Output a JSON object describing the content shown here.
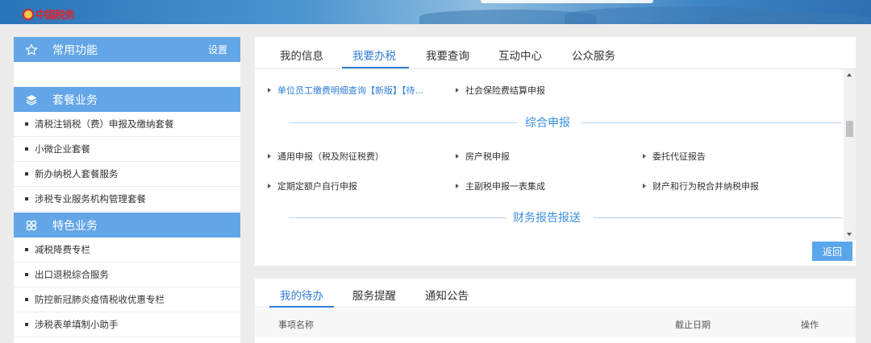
{
  "header": {
    "logo_text": "中国税务"
  },
  "sidebar": {
    "common": {
      "title": "常用功能",
      "setting": "设置"
    },
    "package": {
      "title": "套餐业务",
      "items": [
        "清税注销税（费）申报及缴纳套餐",
        "小微企业套餐",
        "新办纳税人套餐服务",
        "涉税专业服务机构管理套餐"
      ]
    },
    "special": {
      "title": "特色业务",
      "items": [
        "减税降费专栏",
        "出口退税综合服务",
        "防控新冠肺炎疫情税收优惠专栏",
        "涉税表单填制小助手"
      ]
    }
  },
  "main": {
    "tabs": [
      "我的信息",
      "我要办税",
      "我要查询",
      "互动中心",
      "公众服务"
    ],
    "active_tab": "我要办税",
    "row0": [
      "单位员工缴费明细查询【新版】【待...",
      "社会保险费结算申报"
    ],
    "section1": "综合申报",
    "row1": [
      "通用申报（税及附征税费）",
      "房产税申报",
      "委托代征报告"
    ],
    "row2": [
      "定期定额户自行申报",
      "主副税申报一表集成",
      "财产和行为税合并纳税申报"
    ],
    "section2": "财务报告报送",
    "back_button": "返回"
  },
  "bottom": {
    "tabs": [
      "我的待办",
      "服务提醒",
      "通知公告"
    ],
    "active_tab": "我的待办",
    "columns": [
      "事项名称",
      "截止日期",
      "操作"
    ]
  },
  "colors": {
    "accent": "#2f7ed8",
    "sidebar_head": "#63a6e8",
    "button": "#5aa6ea"
  }
}
